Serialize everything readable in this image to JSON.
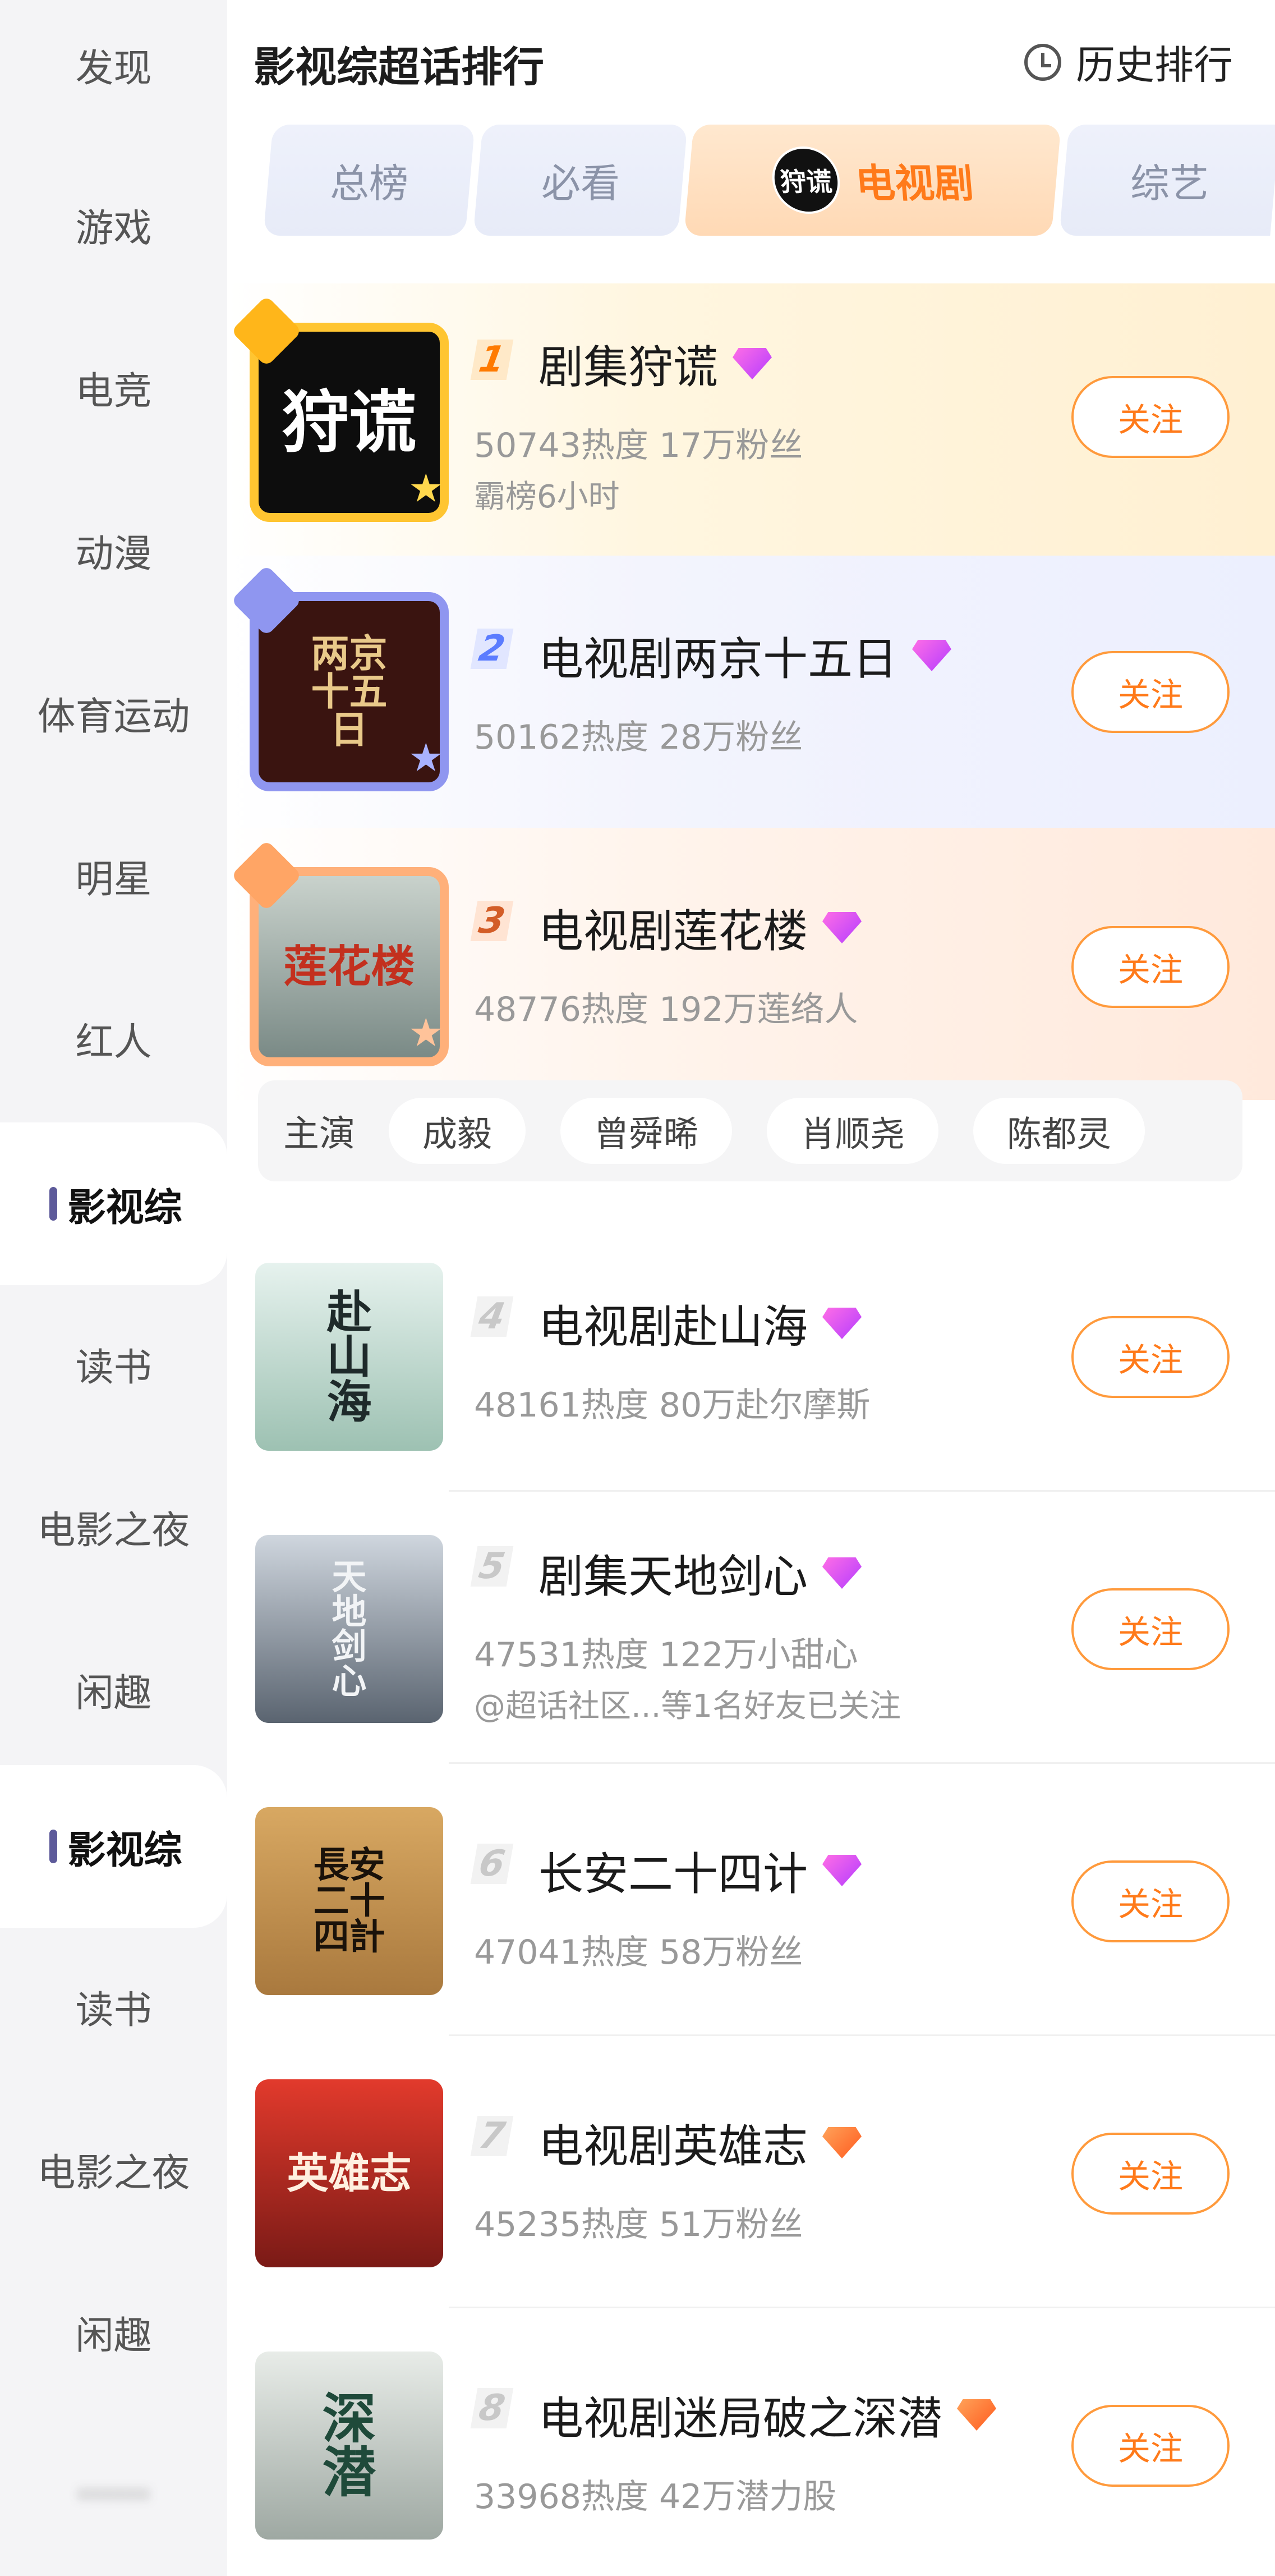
{
  "sidebar": {
    "items": [
      {
        "label": "发现"
      },
      {
        "label": "游戏"
      },
      {
        "label": "电竞"
      },
      {
        "label": "动漫"
      },
      {
        "label": "体育运动"
      },
      {
        "label": "明星"
      },
      {
        "label": "红人"
      },
      {
        "label": "影视综",
        "active": true
      },
      {
        "label": "读书"
      },
      {
        "label": "电影之夜"
      },
      {
        "label": "闲趣"
      },
      {
        "label": "影视综",
        "active": true
      },
      {
        "label": "读书"
      },
      {
        "label": "电影之夜"
      },
      {
        "label": "闲趣"
      },
      {
        "label": "······"
      }
    ]
  },
  "header": {
    "title": "影视综超话排行",
    "history_label": "历史排行",
    "history_icon": "clock-icon"
  },
  "tabs": [
    {
      "label": "总榜"
    },
    {
      "label": "必看"
    },
    {
      "label": "电视剧",
      "logo_text": "狩谎",
      "active": true
    },
    {
      "label": "综艺"
    }
  ],
  "ranking": [
    {
      "rank": "1",
      "title": "剧集狩谎",
      "badge": "pink-diamond-icon",
      "meta": "50743热度 17万粉丝",
      "sub": "霸榜6小时",
      "follow": "关注",
      "cover_text": "狩谎"
    },
    {
      "rank": "2",
      "title": "电视剧两京十五日",
      "badge": "pink-diamond-icon",
      "meta": "50162热度 28万粉丝",
      "follow": "关注",
      "cover_text": "两京十五日"
    },
    {
      "rank": "3",
      "title": "电视剧莲花楼",
      "badge": "pink-diamond-icon",
      "meta": "48776热度 192万莲络人",
      "follow": "关注",
      "cover_text": "莲花楼"
    },
    {
      "rank": "4",
      "title": "电视剧赴山海",
      "badge": "pink-diamond-icon",
      "meta": "48161热度 80万赴尔摩斯",
      "follow": "关注",
      "cover_text": "赴山海"
    },
    {
      "rank": "5",
      "title": "剧集天地剑心",
      "badge": "pink-diamond-icon",
      "meta": "47531热度 122万小甜心",
      "sub": "@超话社区...等1名好友已关注",
      "follow": "关注",
      "cover_text": "天地剑心"
    },
    {
      "rank": "6",
      "title": "长安二十四计",
      "badge": "pink-diamond-icon",
      "meta": "47041热度 58万粉丝",
      "follow": "关注",
      "cover_text": "長安二十四計"
    },
    {
      "rank": "7",
      "title": "电视剧英雄志",
      "badge": "orange-diamond-icon",
      "meta": "45235热度 51万粉丝",
      "follow": "关注",
      "cover_text": "英雄志"
    },
    {
      "rank": "8",
      "title": "电视剧迷局破之深潜",
      "badge": "orange-diamond-icon",
      "meta": "33968热度 42万潜力股",
      "follow": "关注",
      "cover_text": "深潜"
    }
  ],
  "cast": {
    "label": "主演",
    "members": [
      "成毅",
      "曾舜晞",
      "肖顺尧",
      "陈都灵"
    ]
  },
  "colors": {
    "accent": "#ff7a1a",
    "gold": "#ffc531",
    "silver": "#8f96f0",
    "bronze": "#ffb07a",
    "sidebar_bg": "#f4f4f6"
  }
}
